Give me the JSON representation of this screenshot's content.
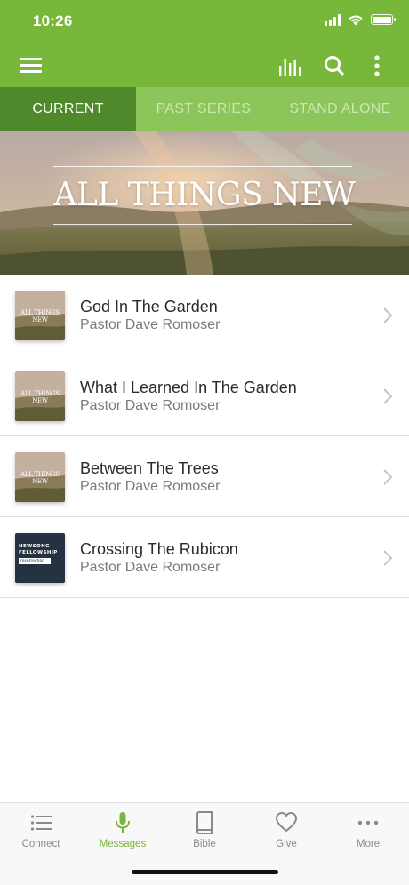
{
  "status_bar": {
    "time": "10:26"
  },
  "colors": {
    "brand_green": "#77b739",
    "tab_active": "#4e8a2b",
    "tab_bar": "#8cc65a"
  },
  "toolbar": {
    "icons": [
      "menu-icon",
      "equalizer-icon",
      "search-icon",
      "more-vertical-icon"
    ]
  },
  "tabs": [
    {
      "label": "CURRENT",
      "active": true
    },
    {
      "label": "PAST SERIES",
      "active": false
    },
    {
      "label": "STAND ALONE",
      "active": false
    }
  ],
  "banner": {
    "title": "ALL THINGS NEW"
  },
  "messages": [
    {
      "title": "God In The Garden",
      "speaker": "Pastor Dave Romoser",
      "thumb_text": "ALL THINGS NEW"
    },
    {
      "title": "What I Learned In The Garden",
      "speaker": "Pastor Dave Romoser",
      "thumb_text": "ALL THINGS NEW"
    },
    {
      "title": "Between The Trees",
      "speaker": "Pastor Dave Romoser",
      "thumb_text": "ALL THINGS NEW"
    },
    {
      "title": "Crossing The Rubicon",
      "speaker": "Pastor Dave Romoser",
      "thumb_text_line1": "NEWSONG",
      "thumb_text_line2": "FELLOWSHIP",
      "thumb_text_sub": "resurrection sunday"
    }
  ],
  "bottom_nav": [
    {
      "label": "Connect",
      "icon": "list-icon",
      "active": false
    },
    {
      "label": "Messages",
      "icon": "microphone-icon",
      "active": true
    },
    {
      "label": "Bible",
      "icon": "book-icon",
      "active": false
    },
    {
      "label": "Give",
      "icon": "heart-icon",
      "active": false
    },
    {
      "label": "More",
      "icon": "more-horizontal-icon",
      "active": false
    }
  ]
}
